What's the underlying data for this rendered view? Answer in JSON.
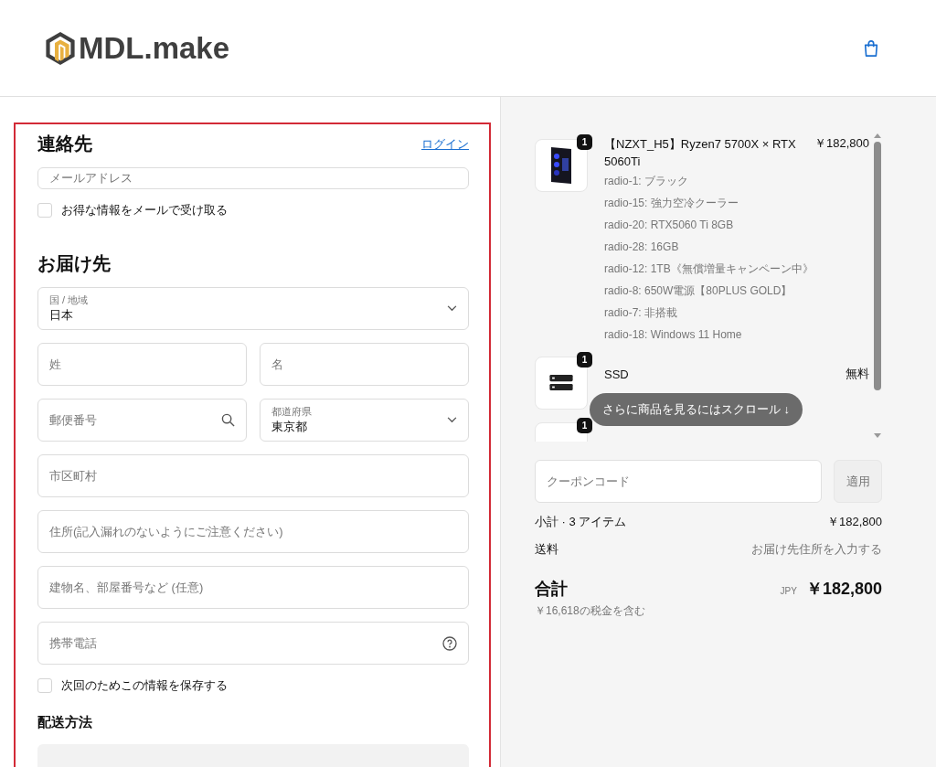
{
  "header": {
    "logo_text": "MDL.make"
  },
  "contact": {
    "title": "連絡先",
    "login_link": "ログイン",
    "email_placeholder": "メールアドレス",
    "newsletter": {
      "label": "お得な情報をメールで受け取る",
      "checked": false
    }
  },
  "delivery": {
    "title": "お届け先",
    "rows": [
      [
        {
          "kind": "select",
          "label": "国 / 地域",
          "value": "日本"
        }
      ],
      [
        {
          "kind": "text",
          "placeholder": "姓"
        },
        {
          "kind": "text",
          "placeholder": "名"
        }
      ],
      [
        {
          "kind": "search",
          "placeholder": "郵便番号"
        },
        {
          "kind": "select",
          "label": "都道府県",
          "value": "東京都"
        }
      ],
      [
        {
          "kind": "text",
          "placeholder": "市区町村"
        }
      ],
      [
        {
          "kind": "text",
          "placeholder": "住所(記入漏れのないようにご注意ください)"
        }
      ],
      [
        {
          "kind": "text",
          "placeholder": "建物名、部屋番号など (任意)"
        }
      ],
      [
        {
          "kind": "help",
          "placeholder": "携帯電話"
        }
      ]
    ],
    "save_info": {
      "label": "次回のためこの情報を保存する",
      "checked": false
    }
  },
  "shipping": {
    "title": "配送方法"
  },
  "cart": {
    "items": [
      {
        "kind": "pc",
        "quantity": "1",
        "title": "【NZXT_H5】Ryzen7 5700X × RTX 5060Ti",
        "price": "￥182,800",
        "options": [
          "radio-1: ブラック",
          "radio-15: 強力空冷クーラー",
          "radio-20: RTX5060 Ti 8GB",
          "radio-28: 16GB",
          "radio-12: 1TB《無償増量キャンペーン中》",
          "radio-8: 650W電源【80PLUS GOLD】",
          "radio-7: 非搭載",
          "radio-18: Windows 11 Home"
        ]
      },
      {
        "kind": "drive",
        "quantity": "1",
        "title": "SSD",
        "price": "無料"
      },
      {
        "kind": "blank",
        "quantity": "1"
      }
    ],
    "scroll_hint": "さらに商品を見るにはスクロール ↓",
    "coupon_placeholder": "クーポンコード",
    "apply_button": "適用",
    "subtotal_label": "小計 · 3 アイテム",
    "subtotal_value": "￥182,800",
    "shipping_label": "送料",
    "shipping_value": "お届け先住所を入力する",
    "total_label": "合計",
    "currency": "JPY",
    "total_value": "￥182,800",
    "tax_note": "￥16,618の税金を含む"
  }
}
